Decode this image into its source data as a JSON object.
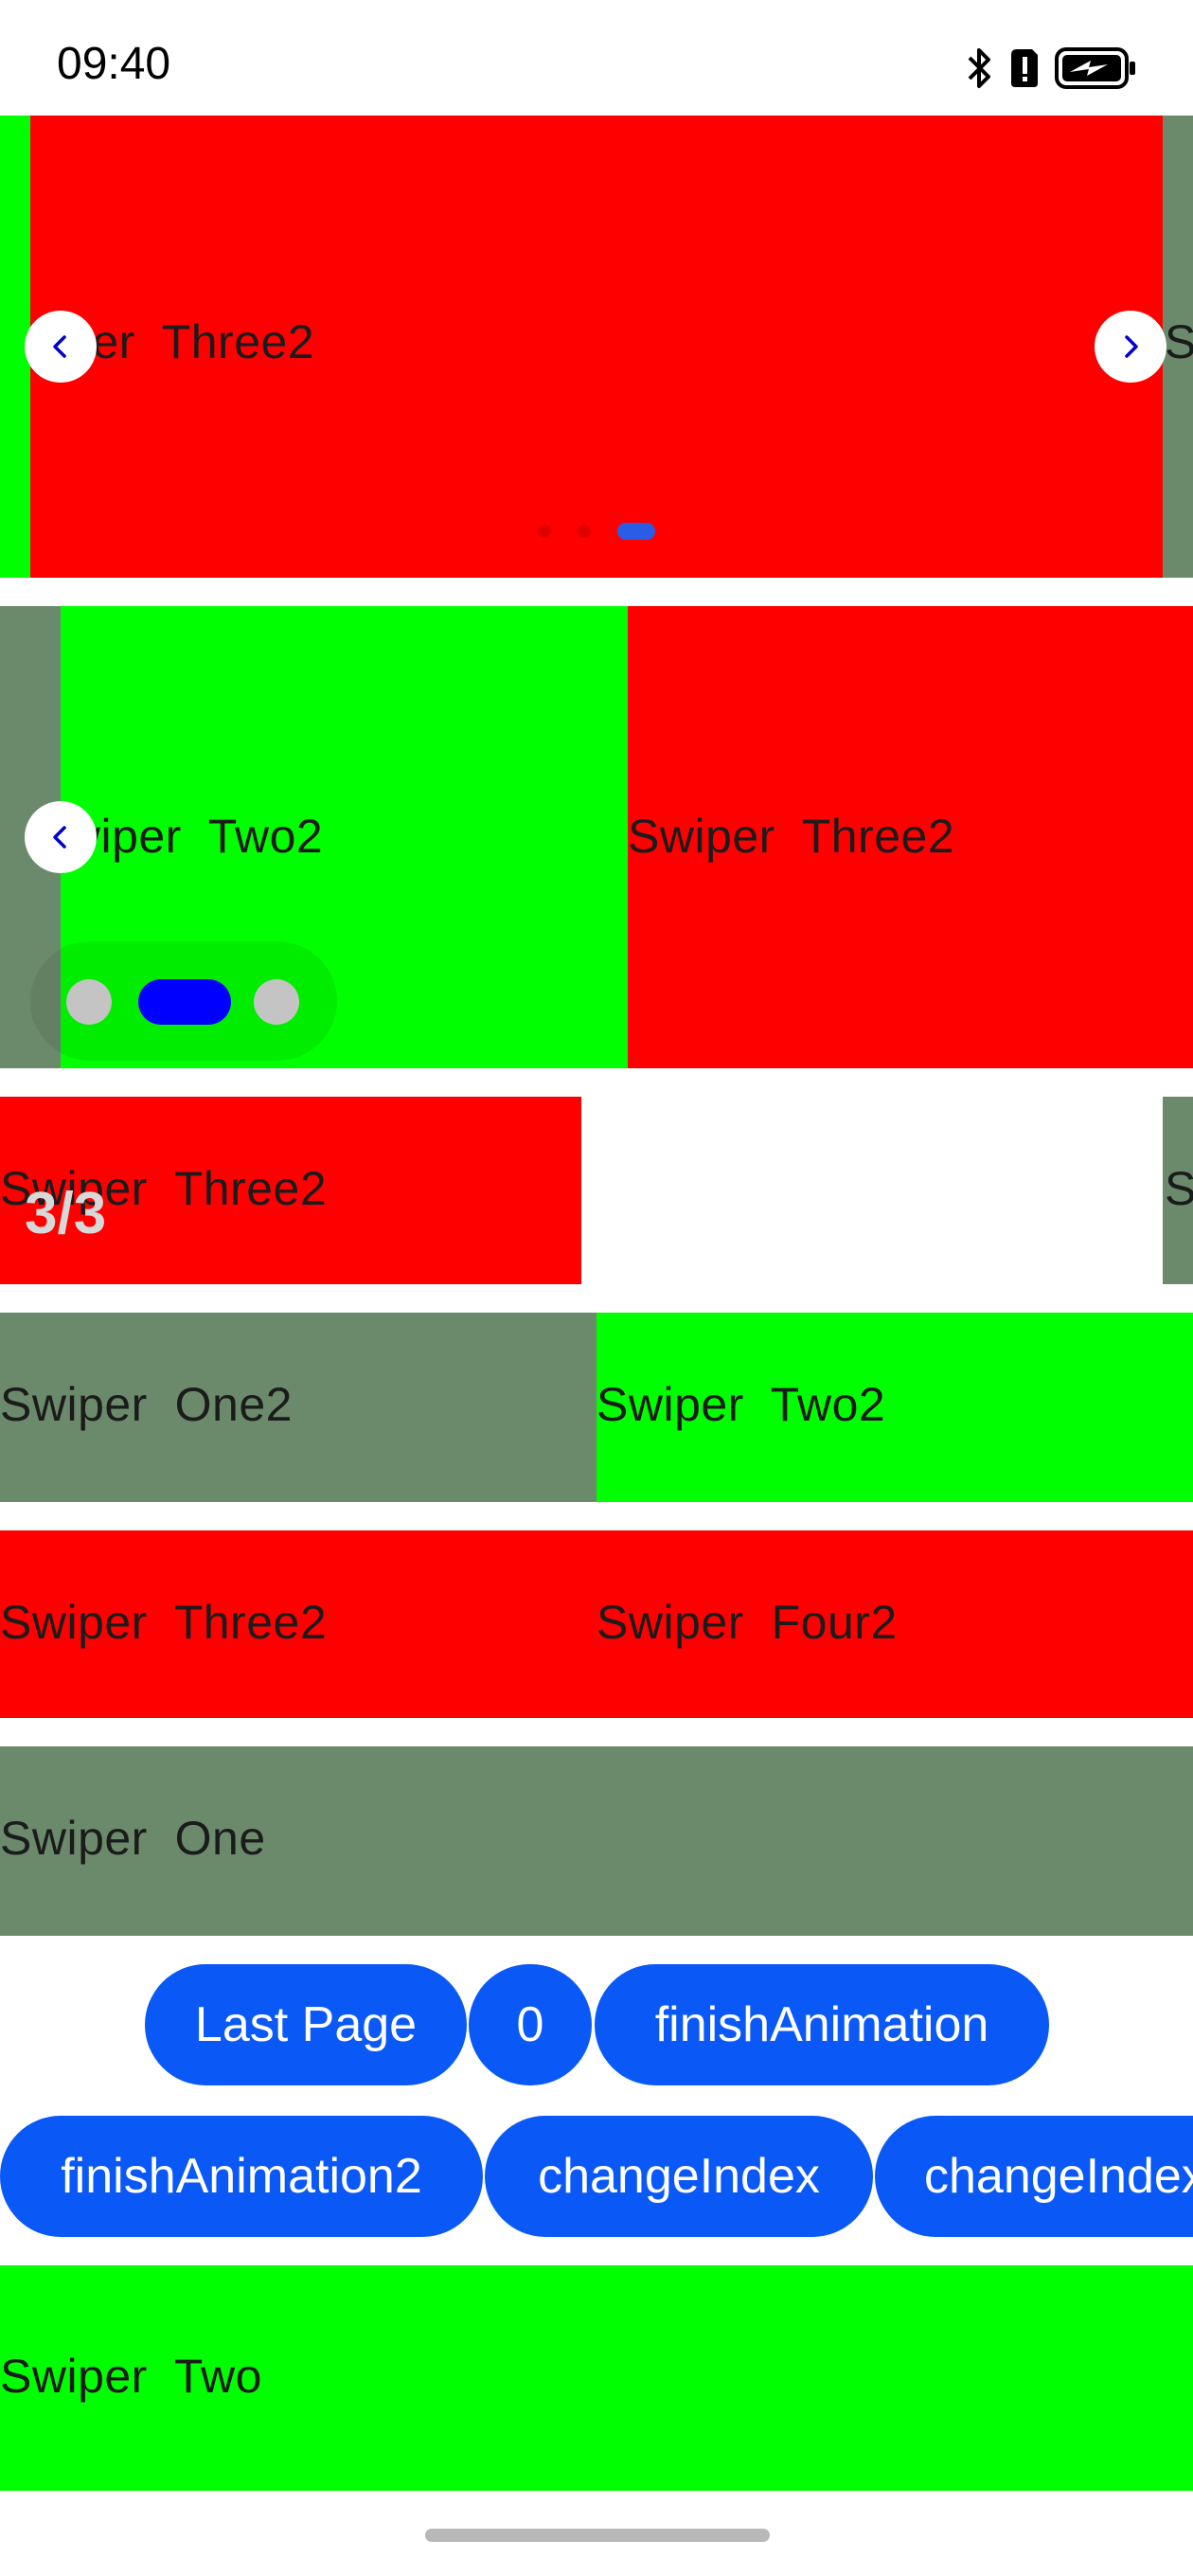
{
  "status": {
    "time": "09:40",
    "icons": [
      "bluetooth-icon",
      "sim-alert-icon",
      "battery-charging-icon"
    ]
  },
  "swiper1": {
    "slides": {
      "left_peek": "",
      "main": "Swiper  Three2",
      "right_peek": "S"
    },
    "indicator": {
      "count": 3,
      "selected": 3
    },
    "colors": {
      "selected_dot": "#2b5ce6",
      "dot": "#e00000"
    }
  },
  "swiper2": {
    "slides": {
      "left": "Swiper  Two2",
      "right": "Swiper  Three2"
    },
    "indicator": {
      "count": 3,
      "selected": 2
    },
    "colors": {
      "selected_dot": "#0000ff",
      "dot": "#c4c4c4"
    }
  },
  "swiper3": {
    "slides": {
      "main": "Swiper  Three2",
      "right_peek": "S"
    },
    "counter": "3/3"
  },
  "swiper4": {
    "slides": [
      "Swiper  One2",
      "Swiper  Two2"
    ]
  },
  "swiper5": {
    "slides": [
      "Swiper  Three2",
      "Swiper  Four2"
    ]
  },
  "swiper6": {
    "slide": "Swiper  One"
  },
  "buttons_row1": [
    "Last Page",
    "0",
    "finishAnimation"
  ],
  "buttons_row2": [
    "finishAnimation2",
    "changeIndex",
    "changeIndex"
  ],
  "swiper7": {
    "slide": "Swiper  Two"
  },
  "palette": {
    "red": "#ff0000",
    "green": "#00ff00",
    "gray": "#6b8a6b",
    "button_blue": "#0a59f7"
  }
}
